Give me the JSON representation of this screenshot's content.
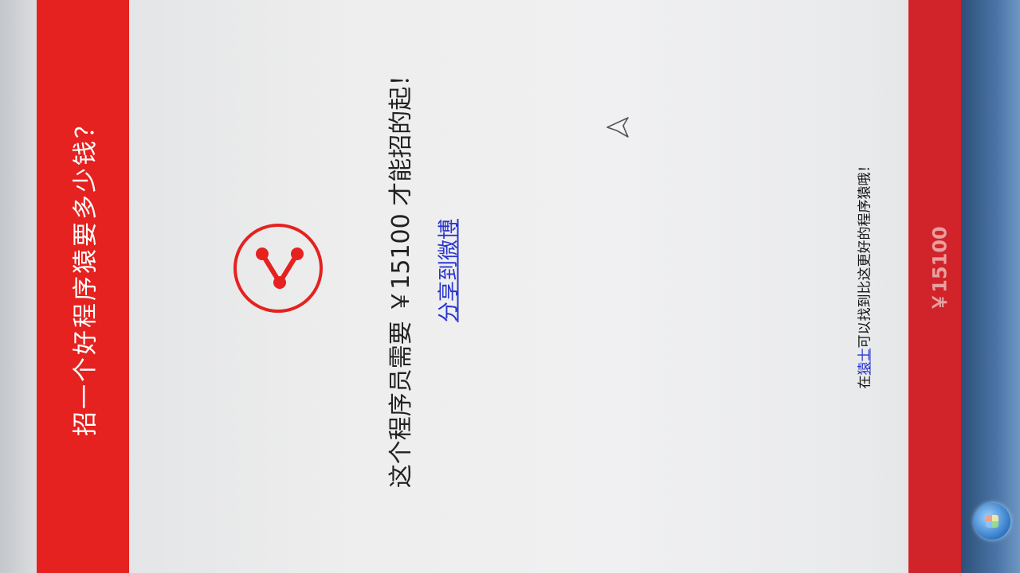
{
  "header": {
    "title": "招一个好程序猿要多少钱？"
  },
  "result": {
    "text": "这个程序员需要 ￥15100 才能招的起！",
    "share_label": "分享到微博"
  },
  "footer": {
    "note_prefix": "在",
    "note_link": "猿士",
    "note_suffix": "可以找到比这更好的程序猿哦！",
    "price": "￥15100"
  },
  "colors": {
    "brand_red": "#e5221f",
    "link_blue": "#2a36cc"
  },
  "icons": {
    "logo": "v-node-logo-icon",
    "cursor": "mouse-pointer-icon",
    "start": "windows-start-icon"
  }
}
